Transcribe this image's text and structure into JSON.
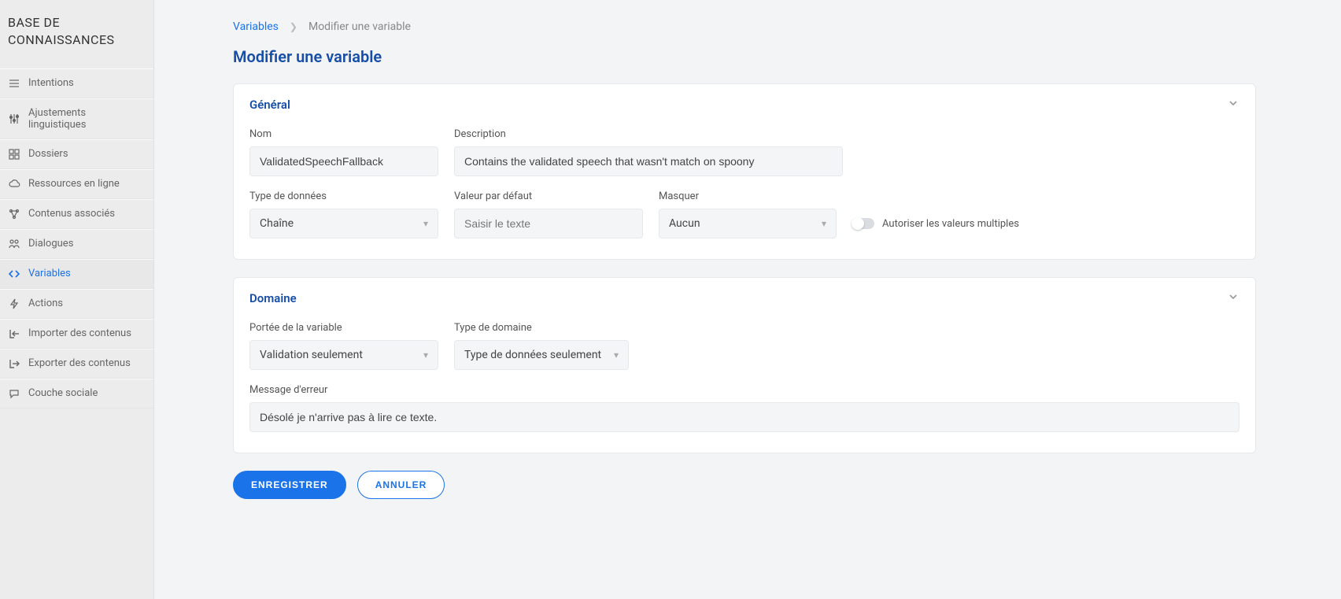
{
  "sidebar": {
    "title": "BASE DE CONNAISSANCES",
    "items": [
      {
        "label": "Intentions",
        "icon": "list-icon"
      },
      {
        "label": "Ajustements linguistiques",
        "icon": "sliders-icon"
      },
      {
        "label": "Dossiers",
        "icon": "grid-icon"
      },
      {
        "label": "Ressources en ligne",
        "icon": "cloud-icon"
      },
      {
        "label": "Contenus associés",
        "icon": "nodes-icon"
      },
      {
        "label": "Dialogues",
        "icon": "people-icon"
      },
      {
        "label": "Variables",
        "icon": "code-icon"
      },
      {
        "label": "Actions",
        "icon": "bolt-icon"
      },
      {
        "label": "Importer des contenus",
        "icon": "import-icon"
      },
      {
        "label": "Exporter des contenus",
        "icon": "export-icon"
      },
      {
        "label": "Couche sociale",
        "icon": "chat-icon"
      }
    ],
    "selected_index": 6
  },
  "breadcrumb": {
    "link_label": "Variables",
    "current": "Modifier une variable"
  },
  "page_title": "Modifier une variable",
  "general": {
    "section_title": "Général",
    "name_label": "Nom",
    "name_value": "ValidatedSpeechFallback",
    "desc_label": "Description",
    "desc_value": "Contains the validated speech that wasn't match on spoony",
    "datatype_label": "Type de données",
    "datatype_value": "Chaîne",
    "default_label": "Valeur par défaut",
    "default_placeholder": "Saisir le texte",
    "default_value": "",
    "mask_label": "Masquer",
    "mask_value": "Aucun",
    "allow_multi_label": "Autoriser les valeurs multiples",
    "allow_multi_on": false
  },
  "domain": {
    "section_title": "Domaine",
    "scope_label": "Portée de la variable",
    "scope_value": "Validation seulement",
    "domain_type_label": "Type de domaine",
    "domain_type_value": "Type de données seulement",
    "error_label": "Message d'erreur",
    "error_value": "Désolé je n'arrive pas à lire ce texte."
  },
  "actions": {
    "save": "ENREGISTRER",
    "cancel": "ANNULER"
  }
}
